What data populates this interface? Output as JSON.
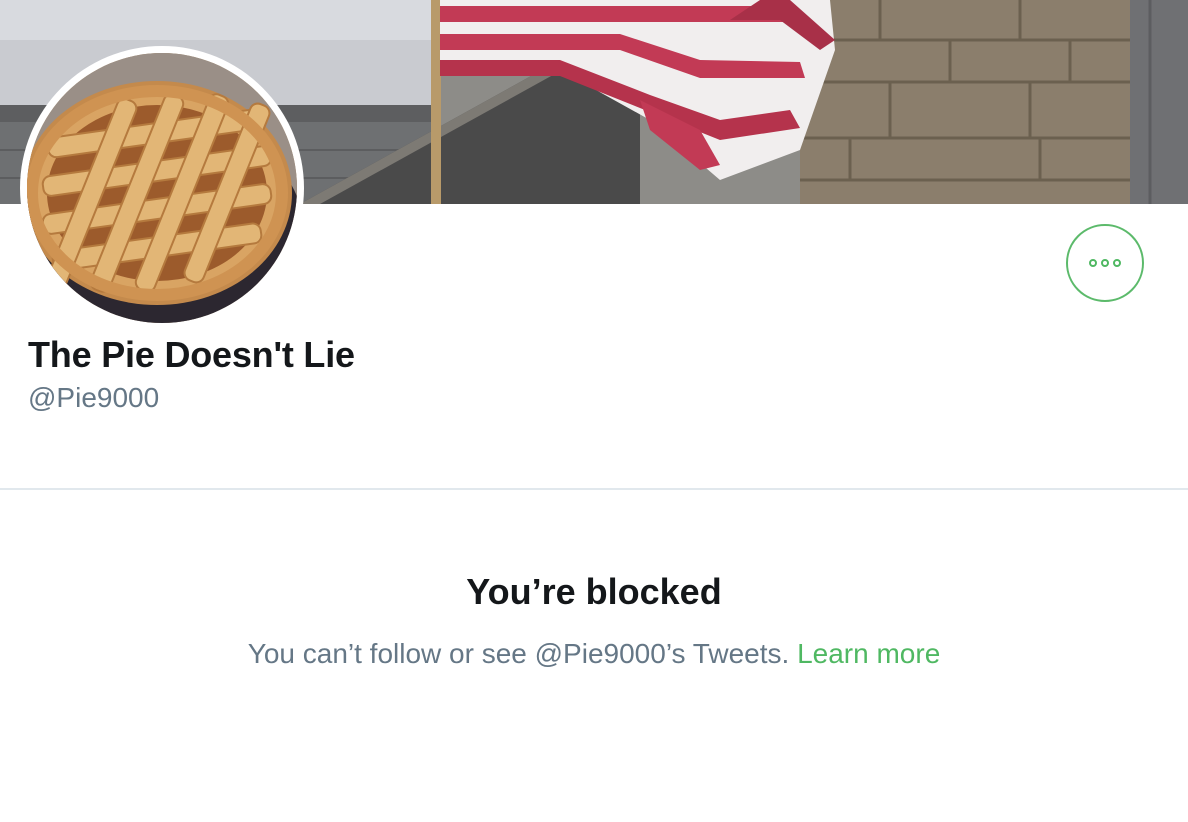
{
  "profile": {
    "display_name": "The Pie Doesn't Lie",
    "handle": "@Pie9000",
    "banner_description": "",
    "avatar_description": ""
  },
  "actions": {
    "more_icon": "more-horizontal-icon"
  },
  "blocked": {
    "title": "You’re blocked",
    "message": "You can’t follow or see @Pie9000’s Tweets.",
    "learn_more_label": "Learn more"
  },
  "colors": {
    "accent": "#4fb862",
    "text_primary": "#14171a",
    "text_secondary": "#657786",
    "divider": "#e1e8ed"
  }
}
